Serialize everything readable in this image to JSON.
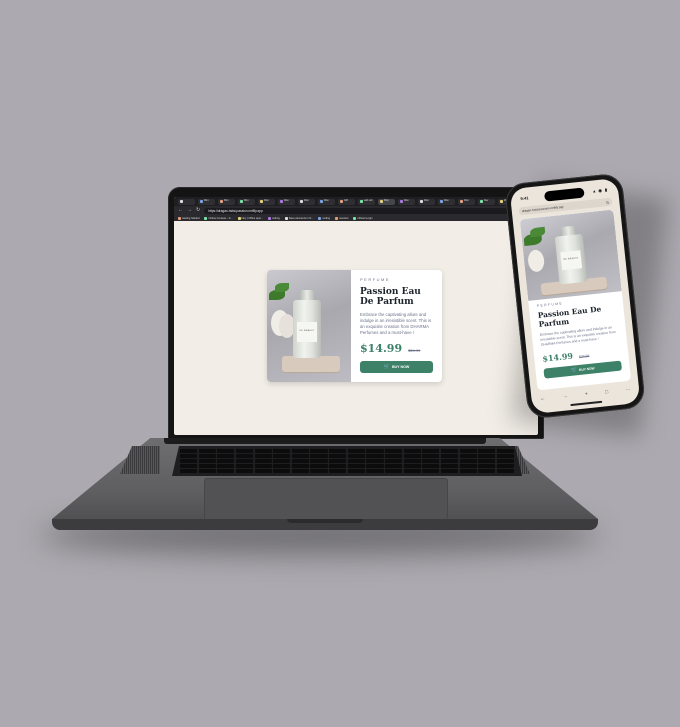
{
  "browser": {
    "tabs": [
      {
        "label": "",
        "active": false
      },
      {
        "label": "Mini",
        "active": false
      },
      {
        "label": "Mini",
        "active": false
      },
      {
        "label": "Mini",
        "active": false
      },
      {
        "label": "Wen",
        "active": false
      },
      {
        "label": "Wen",
        "active": false
      },
      {
        "label": "Wen",
        "active": false
      },
      {
        "label": "Wen",
        "active": false
      },
      {
        "label": "ARI",
        "active": false
      },
      {
        "label": "add sub",
        "active": false
      },
      {
        "label": "Mop",
        "active": true
      },
      {
        "label": "Wen",
        "active": false
      },
      {
        "label": "Wen",
        "active": false
      },
      {
        "label": "Wen",
        "active": false
      },
      {
        "label": "Wen",
        "active": false
      },
      {
        "label": "Dev",
        "active": false
      },
      {
        "label": "Wen",
        "active": false
      }
    ],
    "url": "https://dragan-hstal-passion.netlify.app",
    "bookmarks": [
      "Getting Started",
      "Online Courses - S...",
      "Isby | Office oper...",
      "coding",
      "Save elements in N...",
      "coding",
      "mentors",
      "cPanel Login"
    ]
  },
  "product": {
    "category": "PERFUME",
    "title": "Passion Eau De Parfum",
    "description": "Embrace the captivating allure and indulge in an irresistible scent. This is an exquisite creation from DHARMA Perfumes and a must-have !",
    "price": "$14.99",
    "old_price": "$24.99",
    "button_label": "BUY NOW",
    "bottle_label": "DE BRAEST"
  },
  "phone": {
    "time": "9:41",
    "status_icons": "▴ ◉ ▮",
    "url": "dragan-hstal-passion.netlify.app",
    "toolbar": [
      "←",
      "→",
      "+",
      "□",
      "···"
    ]
  },
  "colors": {
    "accent": "#3d8168",
    "page_bg": "#f2ede7",
    "background": "#acaab0"
  }
}
